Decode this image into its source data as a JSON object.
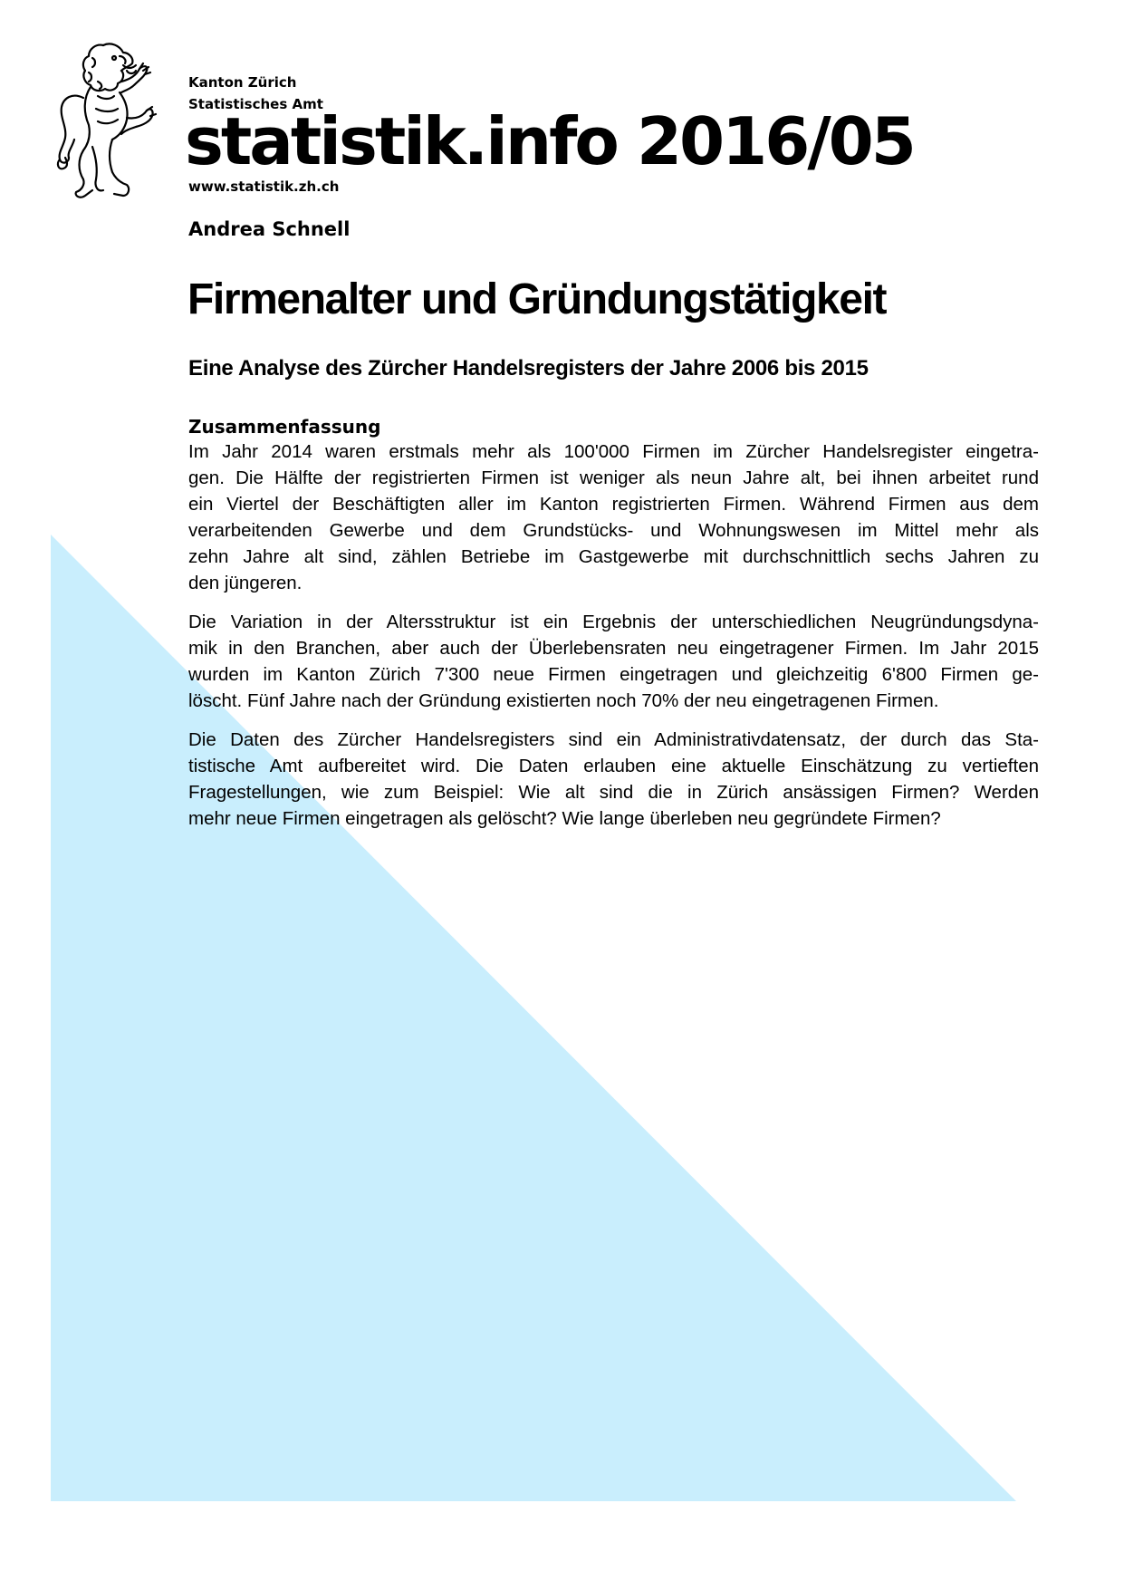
{
  "header": {
    "org_line1": "Kanton Zürich",
    "org_line2": "Statistisches Amt",
    "brand": "statistik.info 2016/05",
    "website": "www.statistik.zh.ch",
    "logo_icon": "zurich-lion-icon"
  },
  "author": "Andrea Schnell",
  "title": "Firmenalter und Gründungstätigkeit",
  "subtitle": "Eine Analyse des Zürcher Handelsregisters der Jahre 2006 bis 2015",
  "summary": {
    "heading": "Zusammenfassung",
    "paragraphs": [
      {
        "lines": [
          "Im Jahr 2014 waren erstmals mehr als 100'000 Firmen im Zürcher Handelsregister eingetra-",
          "gen. Die Hälfte der registrierten Firmen ist weniger als neun Jahre alt, bei ihnen arbeitet rund",
          "ein Viertel der Beschäftigten aller im Kanton registrierten Firmen. Während Firmen aus dem",
          "verarbeitenden Gewerbe und dem Grundstücks- und Wohnungswesen im Mittel mehr als",
          "zehn Jahre alt sind, zählen Betriebe im Gastgewerbe mit durchschnittlich sechs Jahren zu",
          "den jüngeren."
        ]
      },
      {
        "lines": [
          "Die Variation in der Altersstruktur ist ein Ergebnis der unterschiedlichen Neugründungsdyna-",
          "mik in den Branchen, aber auch der Überlebensraten neu eingetragener Firmen. Im Jahr 2015",
          "wurden im Kanton Zürich 7'300 neue Firmen eingetragen und gleichzeitig 6'800 Firmen ge-",
          "löscht. Fünf Jahre nach der Gründung existierten noch 70% der neu eingetragenen Firmen."
        ]
      },
      {
        "lines": [
          "Die Daten des Zürcher Handelsregisters sind ein Administrativdatensatz, der durch das Sta-",
          "tistische Amt aufbereitet wird. Die Daten erlauben eine aktuelle Einschätzung zu vertieften",
          "Fragestellungen, wie zum Beispiel: Wie alt sind die in Zürich ansässigen Firmen? Werden",
          "mehr neue Firmen eingetragen als gelöscht? Wie lange überleben neu gegründete Firmen?"
        ]
      }
    ]
  },
  "colors": {
    "triangle": "#c9eefd",
    "text": "#000000",
    "background": "#ffffff"
  }
}
